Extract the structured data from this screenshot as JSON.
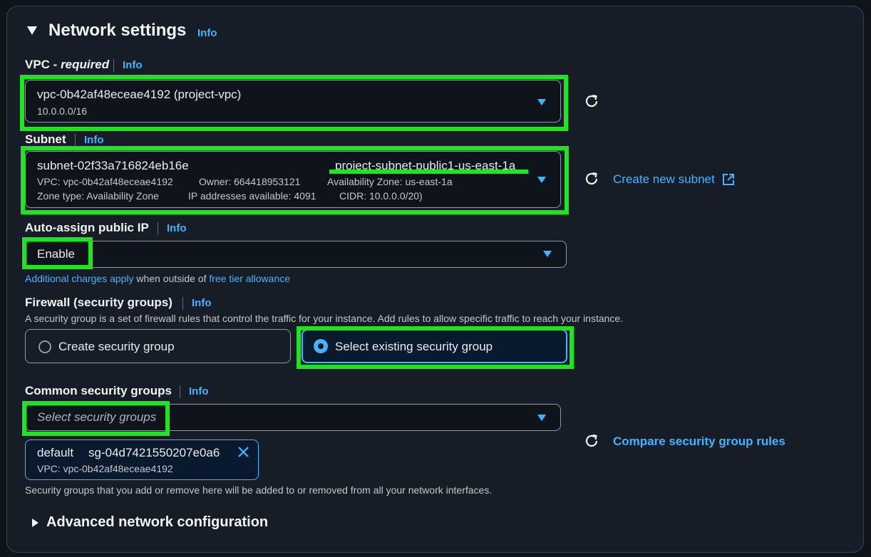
{
  "section": {
    "title": "Network settings",
    "info": "Info"
  },
  "vpc": {
    "label": "VPC - ",
    "label_required": "required",
    "info": "Info",
    "value": "vpc-0b42af48eceae4192 (project-vpc)",
    "cidr": "10.0.0.0/16"
  },
  "subnet": {
    "label": "Subnet",
    "info": "Info",
    "id": "subnet-02f33a716824eb16e",
    "name": "project-subnet-public1-us-east-1a",
    "vpc": "VPC: vpc-0b42af48eceae4192",
    "owner": "Owner: 664418953121",
    "az": "Availability Zone: us-east-1a",
    "zone_type": "Zone type: Availability Zone",
    "ips": "IP addresses available: 4091",
    "cidr": "CIDR: 10.0.0.0/20)",
    "create_link": "Create new subnet"
  },
  "auto_ip": {
    "label": "Auto-assign public IP",
    "info": "Info",
    "value": "Enable",
    "note_link1": "Additional charges apply",
    "note_text": " when outside of ",
    "note_link2": "free tier allowance"
  },
  "firewall": {
    "label": "Firewall (security groups)",
    "info": "Info",
    "description": "A security group is a set of firewall rules that control the traffic for your instance. Add rules to allow specific traffic to reach your instance.",
    "option_create": "Create security group",
    "option_existing": "Select existing security group",
    "selected": "existing"
  },
  "common_sg": {
    "label": "Common security groups",
    "info": "Info",
    "placeholder": "Select security groups",
    "token_name": "default",
    "token_id": "sg-04d7421550207e0a6",
    "token_vpc": "VPC: vpc-0b42af48eceae4192",
    "help": "Security groups that you add or remove here will be added to or removed from all your network interfaces.",
    "compare_link": "Compare security group rules"
  },
  "advanced": {
    "title": "Advanced network configuration"
  },
  "colors": {
    "accent": "#42b4ff",
    "highlight": "#1ee61e",
    "background": "#161d26"
  },
  "icons": [
    "triangle-down-icon",
    "refresh-icon",
    "external-link-icon",
    "close-icon",
    "triangle-right-icon",
    "caret-down-icon"
  ]
}
